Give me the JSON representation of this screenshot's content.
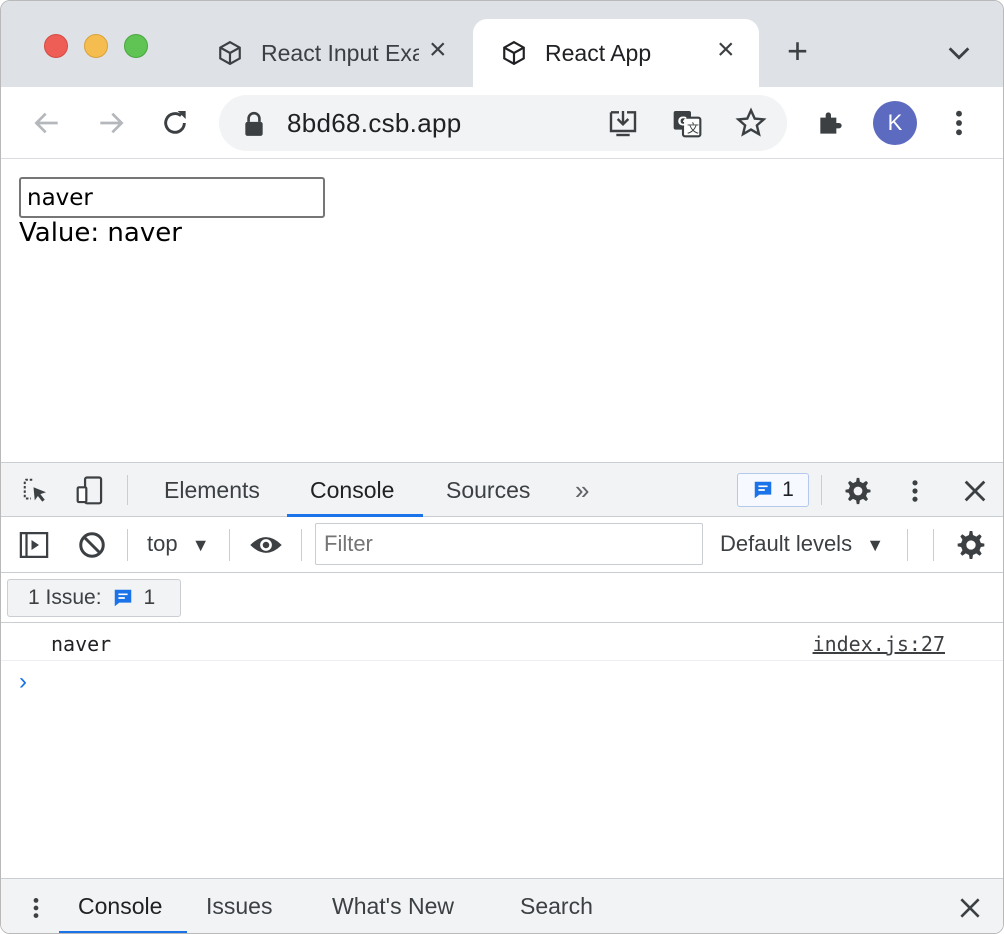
{
  "browser": {
    "tabs": [
      {
        "title": "React Input Example",
        "active": false
      },
      {
        "title": "React App",
        "active": true
      }
    ],
    "new_tab_icon": "plus-icon",
    "url": "8bd68.csb.app",
    "profile_initial": "K",
    "accent_color": "#1a73e8",
    "avatar_color": "#5c6bc0"
  },
  "page": {
    "input_value": "naver",
    "value_label": "Value: naver"
  },
  "devtools": {
    "tabs": [
      "Elements",
      "Console",
      "Sources"
    ],
    "active_tab": "Console",
    "issues_count": "1",
    "filterbar": {
      "context": "top",
      "filter_placeholder": "Filter",
      "levels": "Default levels"
    },
    "issues_chip": {
      "label": "1 Issue:",
      "count": "1"
    },
    "console": {
      "messages": [
        {
          "text": "naver",
          "source": "index.js:27"
        }
      ]
    },
    "drawer": {
      "tabs": [
        "Console",
        "Issues",
        "What's New",
        "Search"
      ],
      "active_tab": "Console"
    }
  }
}
